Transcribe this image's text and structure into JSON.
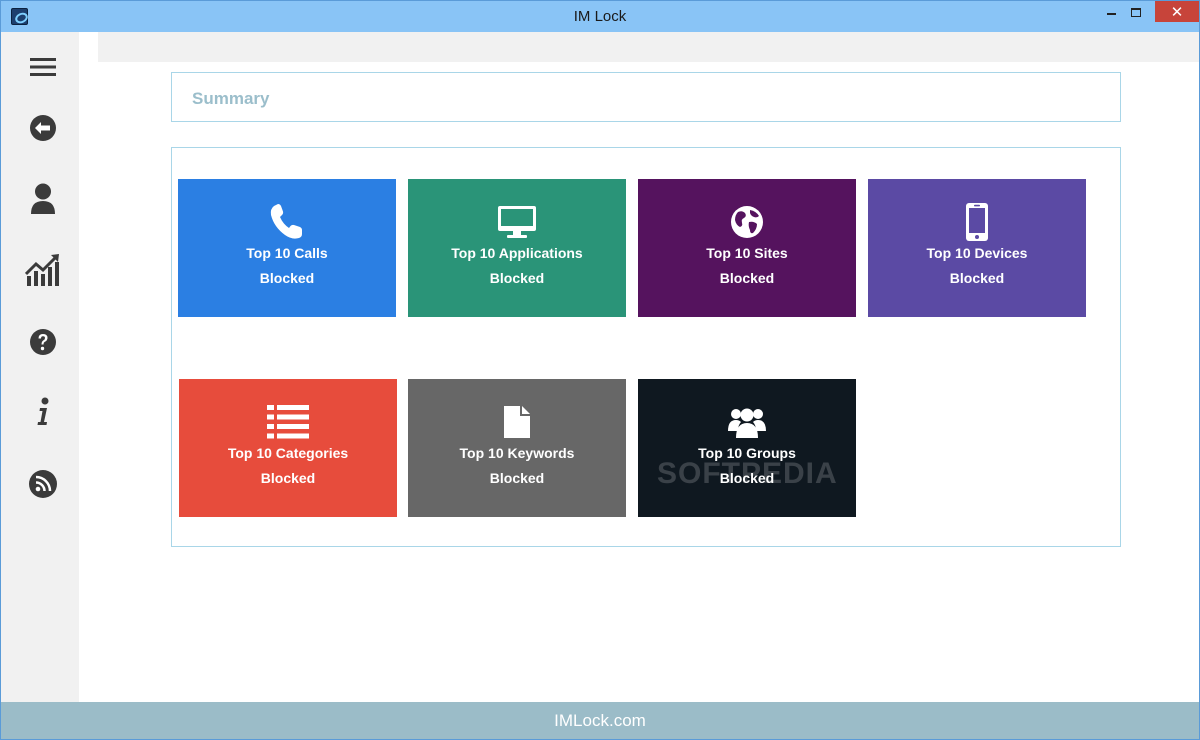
{
  "window": {
    "title": "IM Lock",
    "close_label": "✕"
  },
  "sidebar": {
    "items": [
      {
        "icon": "menu-icon"
      },
      {
        "icon": "back-arrow-icon"
      },
      {
        "icon": "user-icon"
      },
      {
        "icon": "chart-icon"
      },
      {
        "icon": "help-icon"
      },
      {
        "icon": "info-icon"
      },
      {
        "icon": "rss-icon"
      }
    ]
  },
  "summary": {
    "title": "Summary"
  },
  "tiles": [
    {
      "line1": "Top 10 Calls",
      "line2": "Blocked",
      "color": "#2b7fe3",
      "icon": "phone-icon"
    },
    {
      "line1": "Top 10 Applications",
      "line2": "Blocked",
      "color": "#2a9478",
      "icon": "monitor-icon"
    },
    {
      "line1": "Top 10 Sites",
      "line2": "Blocked",
      "color": "#55135e",
      "icon": "globe-icon"
    },
    {
      "line1": "Top 10 Devices",
      "line2": "Blocked",
      "color": "#5b4aa4",
      "icon": "mobile-icon"
    },
    {
      "line1": "Top 10 Categories",
      "line2": "Blocked",
      "color": "#e74c3c",
      "icon": "list-icon"
    },
    {
      "line1": "Top 10 Keywords",
      "line2": "Blocked",
      "color": "#676767",
      "icon": "document-icon"
    },
    {
      "line1": "Top 10 Groups",
      "line2": "Blocked",
      "color": "#0f1820",
      "icon": "group-icon"
    }
  ],
  "footer": {
    "text": "IMLock.com"
  },
  "watermark": {
    "text": "SOFTPEDIA"
  }
}
